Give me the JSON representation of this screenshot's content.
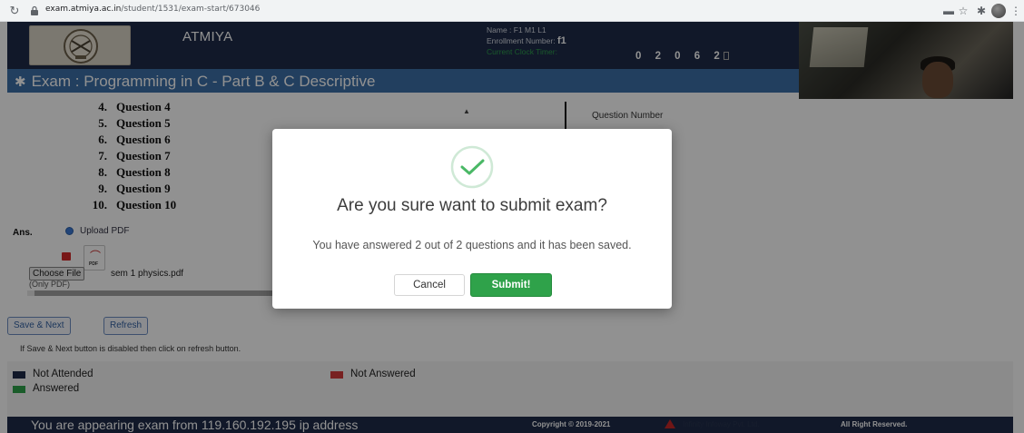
{
  "browser": {
    "url_host": "exam.atmiya.ac.in",
    "url_path": "/student/1531/exam-start/673046"
  },
  "header": {
    "brand": "ATMIYA",
    "name_line": "Name : F1 M1 L1",
    "enrollment_label": "Enrollment Number:",
    "enrollment_value": "f1",
    "clock_label": "Current Clock Timer:",
    "timer": "0 2 0 6 2"
  },
  "exam": {
    "title": "Exam : Programming in C - Part B & C Descriptive"
  },
  "questions": [
    {
      "num": "4.",
      "label": "Question 4"
    },
    {
      "num": "5.",
      "label": "Question 5"
    },
    {
      "num": "6.",
      "label": "Question 6"
    },
    {
      "num": "7.",
      "label": "Question 7"
    },
    {
      "num": "8.",
      "label": "Question 8"
    },
    {
      "num": "9.",
      "label": "Question 9"
    },
    {
      "num": "10.",
      "label": "Question 10"
    }
  ],
  "side_panel": {
    "question_number_label": "Question Number"
  },
  "answer": {
    "label": "Ans.",
    "option_upload": "Upload PDF",
    "pdf_icon_text": "PDF",
    "choose_file": "Choose File",
    "file_name": "sem 1 physics.pdf",
    "only_pdf": "(Only PDF)"
  },
  "actions": {
    "save_next": "Save & Next",
    "refresh": "Refresh",
    "hint": "If Save & Next button is disabled then click on refresh button."
  },
  "legend": {
    "not_attended": "Not Attended",
    "not_answered": "Not Answered",
    "answered": "Answered",
    "colors": {
      "not_attended": "#1e2b48",
      "not_answered": "#d43a3a",
      "answered": "#2fa24a"
    }
  },
  "footer": {
    "ip_text": "You are appearing exam from 119.160.192.195 ip address",
    "copyright": "Copyright © 2019-2021",
    "company": "Infinity Infoway Pvt. Ltd.",
    "rights": "All Right Reserved."
  },
  "modal": {
    "title": "Are you sure want to submit exam?",
    "message": "You have answered 2 out of 2 questions and it has been saved.",
    "cancel": "Cancel",
    "submit": "Submit!"
  },
  "icons": {
    "reload": "reload-icon",
    "lock": "lock-icon",
    "success": "check-circle-icon",
    "pdf": "pdf-file-icon",
    "delete": "delete-icon"
  }
}
